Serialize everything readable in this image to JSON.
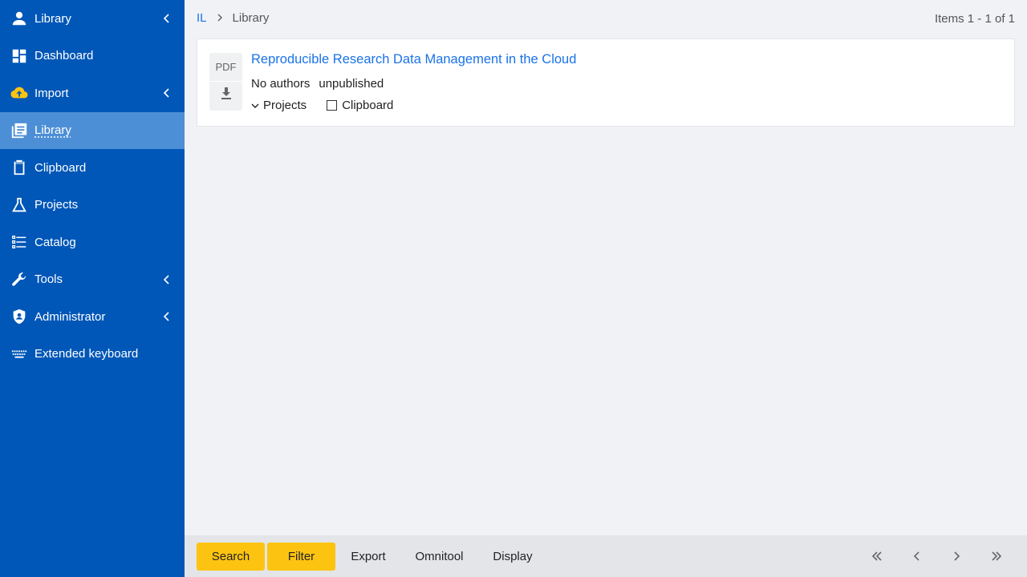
{
  "sidebar": {
    "items": [
      {
        "label": "Library",
        "icon": "user-icon",
        "has_chevron": true
      },
      {
        "label": "Dashboard",
        "icon": "dashboard-icon",
        "has_chevron": false
      },
      {
        "label": "Import",
        "icon": "cloud-upload-icon",
        "has_chevron": true
      },
      {
        "label": "Library",
        "icon": "library-icon",
        "has_chevron": false,
        "active": true
      },
      {
        "label": "Clipboard",
        "icon": "clipboard-icon",
        "has_chevron": false
      },
      {
        "label": "Projects",
        "icon": "flask-icon",
        "has_chevron": false
      },
      {
        "label": "Catalog",
        "icon": "list-icon",
        "has_chevron": false
      },
      {
        "label": "Tools",
        "icon": "wrench-icon",
        "has_chevron": true
      },
      {
        "label": "Administrator",
        "icon": "shield-user-icon",
        "has_chevron": true
      },
      {
        "label": "Extended keyboard",
        "icon": "keyboard-icon",
        "has_chevron": false
      }
    ]
  },
  "header": {
    "breadcrumb_root": "IL",
    "breadcrumb_current": "Library",
    "items_count": "Items 1 - 1 of 1"
  },
  "item": {
    "file_type": "PDF",
    "title": "Reproducible Research Data Management in the Cloud",
    "authors": "No authors",
    "status": "unpublished",
    "projects_label": "Projects",
    "clipboard_label": "Clipboard"
  },
  "toolbar": {
    "search": "Search",
    "filter": "Filter",
    "export": "Export",
    "omnitool": "Omnitool",
    "display": "Display"
  },
  "colors": {
    "sidebar_bg": "#0057b8",
    "sidebar_active": "#4d8fd6",
    "accent_yellow": "#fcc411",
    "link_blue": "#1a73e8"
  }
}
